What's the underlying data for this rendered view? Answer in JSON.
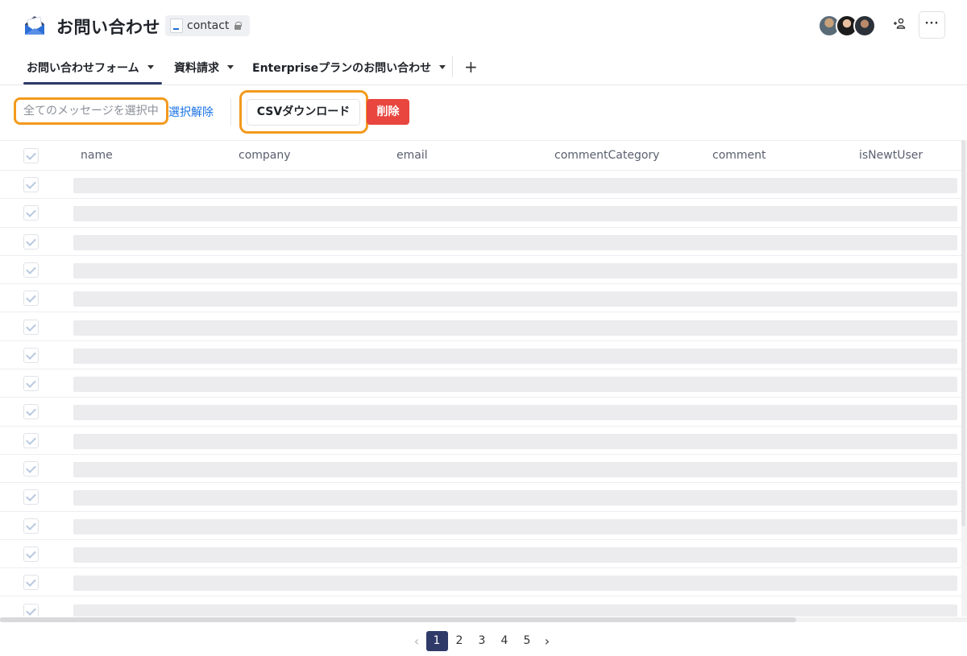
{
  "header": {
    "title": "お問い合わせ",
    "slug": "contact",
    "more_label": "···",
    "add_user_label": "+"
  },
  "tabs": [
    {
      "label": "お問い合わせフォーム",
      "active": true
    },
    {
      "label": "資料請求",
      "active": false
    },
    {
      "label": "Enterpriseプランのお問い合わせ",
      "active": false
    }
  ],
  "tab_add_label": "+",
  "toolbar": {
    "select_status": "全てのメッセージを選択中",
    "deselect_label": "選択解除",
    "csv_label": "CSVダウンロード",
    "delete_label": "削除"
  },
  "table": {
    "columns": [
      "name",
      "company",
      "email",
      "commentCategory",
      "comment",
      "isNewtUser"
    ],
    "row_count": 16
  },
  "pagination": {
    "pages": [
      "1",
      "2",
      "3",
      "4",
      "5"
    ],
    "current": "1",
    "prev": "‹",
    "next": "›"
  },
  "colors": {
    "accent": "#2f3a68",
    "highlight": "#f39a1d",
    "danger": "#e8463f",
    "link": "#1a73e8"
  }
}
